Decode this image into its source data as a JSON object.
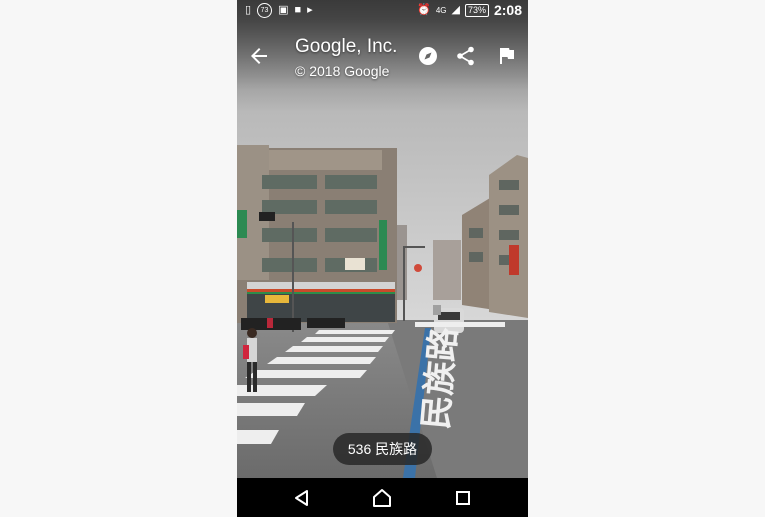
{
  "status_bar": {
    "notification_badge": "73",
    "network": "4G",
    "battery": "73%",
    "time": "2:08"
  },
  "app_bar": {
    "title": "Google, Inc.",
    "subtitle": "© 2018 Google"
  },
  "address_chip": {
    "label": "536 民族路"
  },
  "road_marking": "民族路",
  "icons": {
    "back": "arrow-left-icon",
    "compass": "compass-icon",
    "share": "share-icon",
    "report": "flag-icon",
    "nav_back": "triangle-back-icon",
    "nav_home": "circle-home-icon",
    "nav_recents": "square-recents-icon"
  }
}
